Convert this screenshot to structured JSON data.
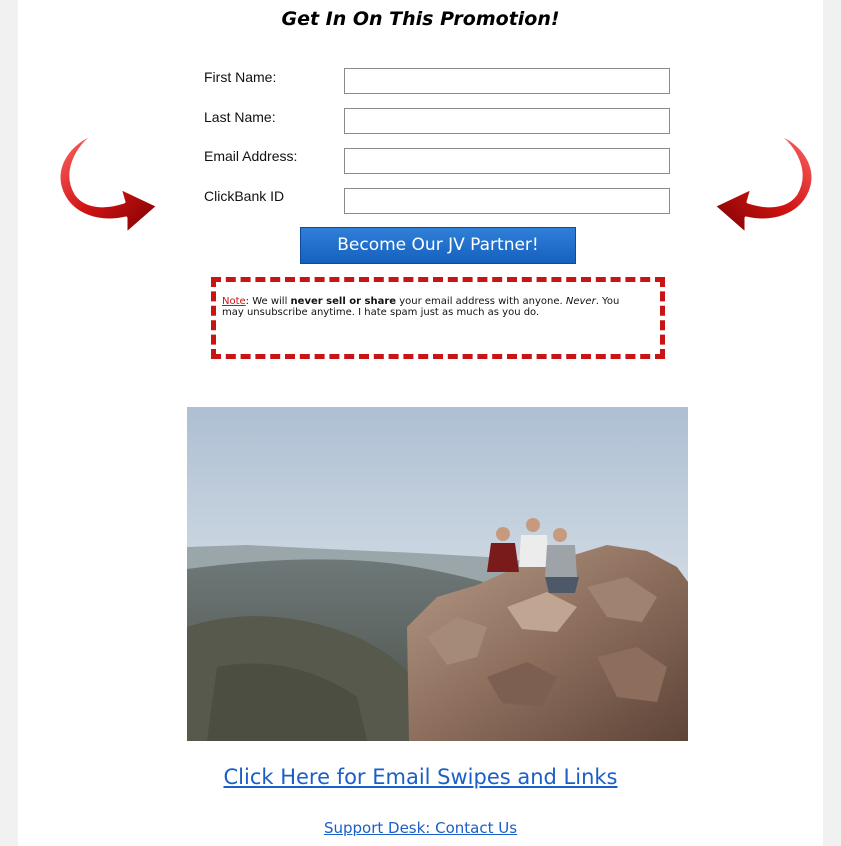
{
  "headline": "Get In On This Promotion!",
  "form": {
    "fields": [
      {
        "label": "First Name:",
        "value": "",
        "placeholder": ""
      },
      {
        "label": "Last Name:",
        "value": "",
        "placeholder": ""
      },
      {
        "label": "Email Address:",
        "value": "",
        "placeholder": ""
      },
      {
        "label": "ClickBank ID",
        "value": "",
        "placeholder": ""
      }
    ],
    "submit_label": "Become Our JV Partner!"
  },
  "note": {
    "label": "Note",
    "text_1": ": We will ",
    "bold_1": "never sell or share",
    "text_2": " your email address with anyone. ",
    "italic_1": "Never",
    "text_3": ". You may unsubscribe anytime. I hate spam just as much as you do."
  },
  "links": {
    "swipes": "Click Here for Email Swipes and Links",
    "support": "Support Desk: Contact Us"
  },
  "colors": {
    "accent_red": "#c81414",
    "button_blue": "#1f6ccb",
    "link_blue": "#1a5fc8"
  },
  "icons": {
    "left_arrow": "curved-arrow-right-icon",
    "right_arrow": "curved-arrow-left-icon"
  }
}
